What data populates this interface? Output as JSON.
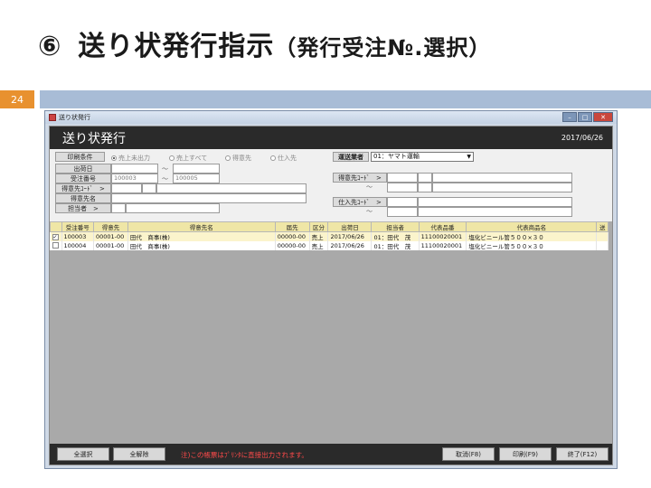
{
  "slide": {
    "title_num": "⑥",
    "title_main": "送り状発行指示",
    "title_paren": "（発行受注№.選択）",
    "page_number": "24"
  },
  "window": {
    "caption": "送り状発行",
    "header_title": "送り状発行",
    "date": "2017/06/26"
  },
  "form": {
    "print_cond_label": "印刷条件",
    "radios": [
      {
        "label": "売上未出力",
        "selected": true
      },
      {
        "label": "売上すべて",
        "selected": false
      },
      {
        "label": "得意先",
        "selected": false
      },
      {
        "label": "仕入先",
        "selected": false
      }
    ],
    "carrier_label": "運送業者",
    "carrier_value": "01：ヤマト運輸",
    "ship_date_label": "出荷日",
    "order_no_label": "受注番号",
    "order_from": "100003",
    "order_to": "100005",
    "customer_code_label": "得意先ｺｰﾄﾞ　>",
    "customer_name_label": "得意先名",
    "staff_label": "担当者　>",
    "cust_code_label_right": "得意先ｺｰﾄﾞ　>",
    "supplier_code_label": "仕入先ｺｰﾄﾞ　>",
    "tilde": "～"
  },
  "grid": {
    "headers": [
      "",
      "受注番号",
      "得意先",
      "得意先名",
      "届先",
      "区分",
      "出荷日",
      "担当者",
      "代表品番",
      "代表商品名",
      "送"
    ],
    "rows": [
      {
        "checked": "✓",
        "order": "100003",
        "cust": "00001-00",
        "name": "田代　商事(株)",
        "dest": "00000-00",
        "kind": "売上",
        "date": "2017/06/26",
        "staff": "01：田代　茂",
        "code": "11100020001",
        "product": "塩化ビニール管５００×３０",
        "send": ""
      },
      {
        "checked": "",
        "order": "100004",
        "cust": "00001-00",
        "name": "田代　商事(株)",
        "dest": "00000-00",
        "kind": "売上",
        "date": "2017/06/26",
        "staff": "01：田代　茂",
        "code": "11100020001",
        "product": "塩化ビニール管５００×３０",
        "send": ""
      }
    ]
  },
  "footer": {
    "select_all": "全選択",
    "deselect_all": "全解除",
    "note": "注)この帳票はﾌﾟﾘﾝﾀに直接出力されます。",
    "cancel": "取消(F8)",
    "print": "印刷(F9)",
    "exit": "終了(F12)"
  }
}
